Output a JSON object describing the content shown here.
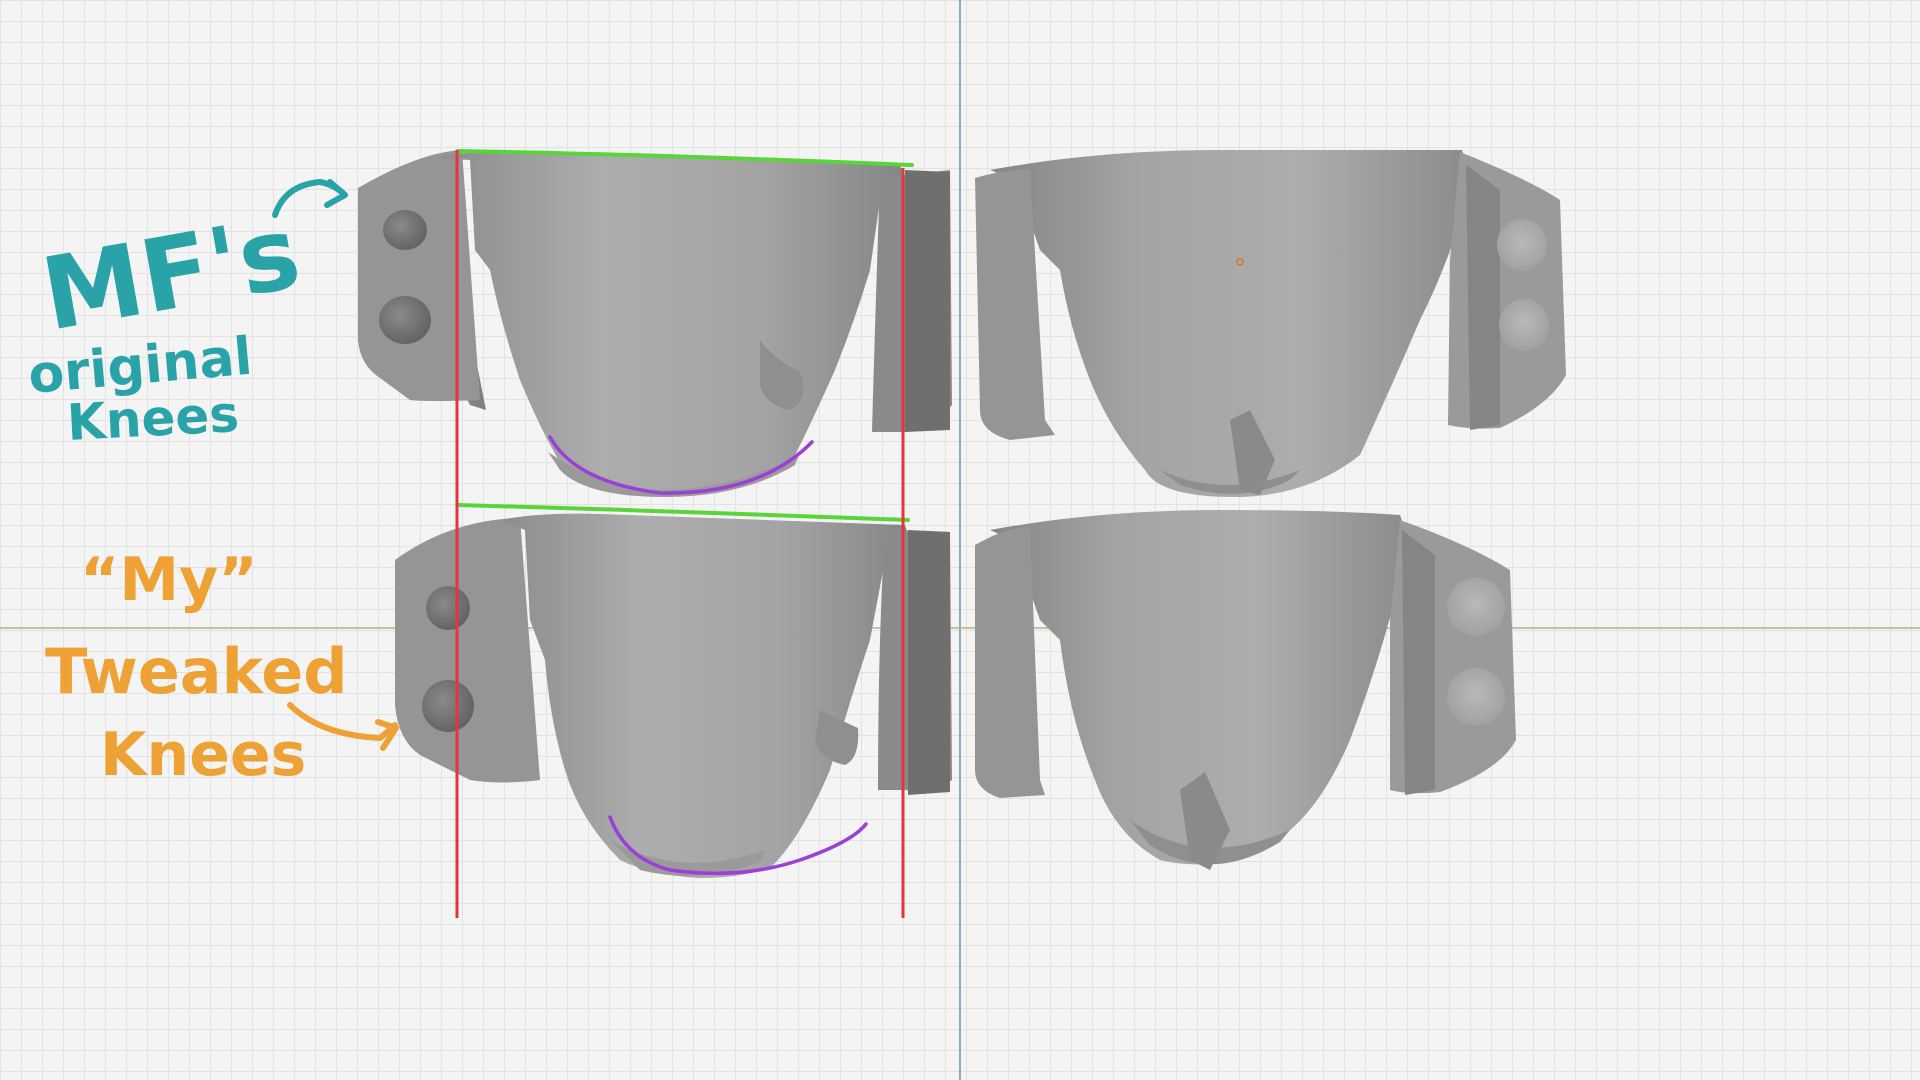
{
  "viewport": {
    "colors": {
      "background": "#f4f4f4",
      "grid": "#e2e2e2",
      "y_axis": "#6b95b8",
      "x_axis": "#a9b97d",
      "model": "#a6a6a6"
    }
  },
  "annotations": {
    "original": {
      "line1": "MF's",
      "line2": "original",
      "line3": "Knees",
      "color": "#2aa3a8"
    },
    "tweaked": {
      "line1": "“My”",
      "line2": "Tweaked",
      "line3": "Knees",
      "color": "#eea236"
    },
    "guide_colors": {
      "top_edge": "#5bd43a",
      "width_line": "#e0363c",
      "bottom_curve": "#9b3fd8"
    }
  },
  "origin_marker": {
    "color": "#d67b1a"
  }
}
